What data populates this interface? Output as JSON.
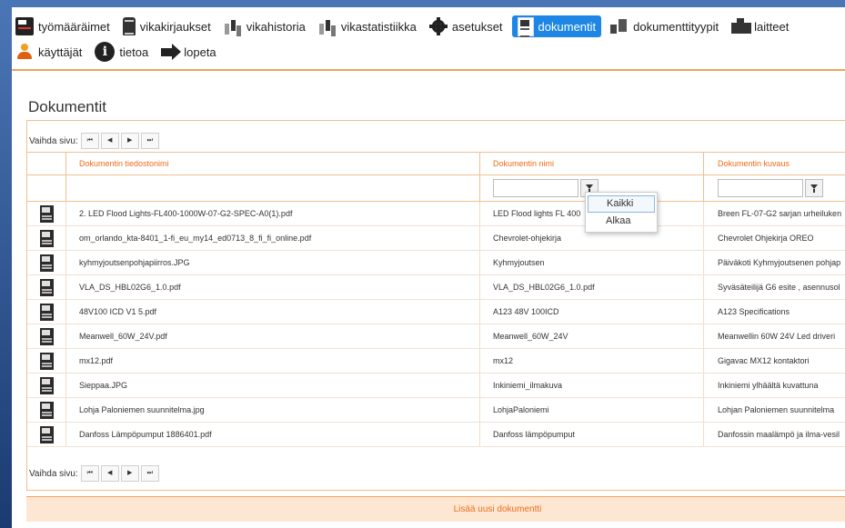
{
  "nav": {
    "row1": [
      {
        "label": "työmääräimet",
        "icon": "book-icon"
      },
      {
        "label": "vikakirjaukset",
        "icon": "trashcan-icon"
      },
      {
        "label": "vikahistoria",
        "icon": "bar-chart-icon"
      },
      {
        "label": "vikastatistiikka",
        "icon": "bar-chart-icon"
      },
      {
        "label": "asetukset",
        "icon": "gear-icon"
      },
      {
        "label": "dokumentit",
        "icon": "document-icon",
        "active": true
      },
      {
        "label": "dokumenttityypit",
        "icon": "document-types-icon"
      },
      {
        "label": "laitteet",
        "icon": "machine-icon"
      }
    ],
    "row2": [
      {
        "label": "käyttäjät",
        "icon": "user-icon"
      },
      {
        "label": "tietoa",
        "icon": "info-icon"
      },
      {
        "label": "lopeta",
        "icon": "arrow-right-icon"
      }
    ],
    "active_color": "#1e87e5",
    "accent_color": "#f0a45c"
  },
  "page_title": "Dokumentit",
  "pager": {
    "label": "Vaihda sivu:",
    "buttons": [
      "⏮",
      "◀",
      "▶",
      "⏭"
    ]
  },
  "columns": {
    "filename": "Dokumentin tiedostonimi",
    "name": "Dokumentin nimi",
    "description": "Dokumentin kuvaus"
  },
  "filter_menu": {
    "options": [
      "Kaikki",
      "Alkaa"
    ],
    "selected": "Kaikki"
  },
  "rows": [
    {
      "filename": "2. LED Flood Lights-FL400-1000W-07-G2-SPEC-A0(1).pdf",
      "name": "LED Flood lights FL 400",
      "description": "Breen FL-07-G2 sarjan urheiluken"
    },
    {
      "filename": "om_orlando_kta-8401_1-fi_eu_my14_ed0713_8_fi_fi_online.pdf",
      "name": "Chevrolet-ohjekirja",
      "description": "Chevrolet Ohjekirja OREO"
    },
    {
      "filename": "kyhmyjoutsenpohjapiirros.JPG",
      "name": "Kyhmyjoutsen",
      "description": "Päiväkoti Kyhmyjoutsenen pohjap"
    },
    {
      "filename": "VLA_DS_HBL02G6_1.0.pdf",
      "name": "VLA_DS_HBL02G6_1.0.pdf",
      "description": "Syväsäteilijä G6 esite , asennusol"
    },
    {
      "filename": "48V100 ICD V1 5.pdf",
      "name": "A123 48V 100ICD",
      "description": "A123 Specifications"
    },
    {
      "filename": "Meanwell_60W_24V.pdf",
      "name": "Meanwell_60W_24V",
      "description": "Meanwellin 60W 24V Led driveri"
    },
    {
      "filename": "mx12.pdf",
      "name": "mx12",
      "description": "Gigavac MX12 kontaktori"
    },
    {
      "filename": "Sieppaa.JPG",
      "name": "Inkiniemi_ilmakuva",
      "description": "Inkiniemi ylhäältä kuvattuna"
    },
    {
      "filename": "Lohja Paloniemen suunnitelma.jpg",
      "name": "LohjaPaloniemi",
      "description": "Lohjan Paloniemen suunnitelma"
    },
    {
      "filename": "Danfoss Lämpöpumput 1886401.pdf",
      "name": "Danfoss lämpöpumput",
      "description": "Danfossin maalämpö ja ilma-vesil"
    }
  ],
  "add_button": "Lisää uusi dokumentti"
}
